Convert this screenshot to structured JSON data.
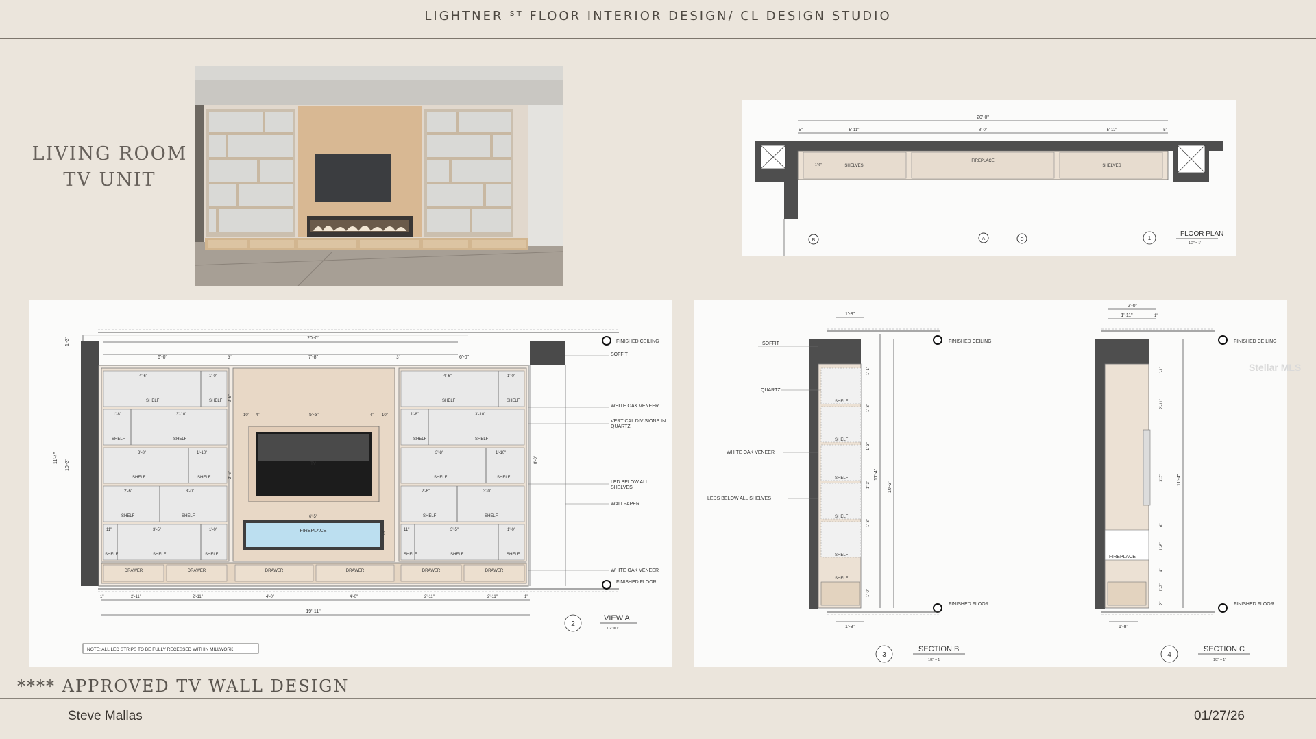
{
  "header": {
    "title": "LIGHTNER ᔆᵀ FLOOR INTERIOR DESIGN/ CL DESIGN STUDIO"
  },
  "side_title": {
    "line1": "LIVING ROOM",
    "line2": "TV UNIT"
  },
  "floor_plan": {
    "overall": "20'-0\"",
    "segments": [
      "5\"",
      "5'-11\"",
      "8'-0\"",
      "5'-11\"",
      "5\""
    ],
    "depth": "1'-6\"",
    "labels": {
      "shelves_left": "SHELVES",
      "fireplace": "FIREPLACE",
      "shelves_right": "SHELVES"
    },
    "markers": [
      "B",
      "A",
      "C"
    ],
    "title_num": "1",
    "title": "FLOOR PLAN",
    "scale": "1/2\" = 1'"
  },
  "view_a": {
    "overall_top": "20'-0\"",
    "top_dims": [
      "6'-0\"",
      "3\"",
      "7'-8\"",
      "3\"",
      "6'-0\""
    ],
    "left_dims": [
      "1'-3\"",
      "11'-4\"",
      "10'-3\""
    ],
    "side_dims": [
      "2'-6\"",
      "1'-3\"",
      "2'-6\"",
      "1'-3\"",
      "8'-0\""
    ],
    "tv_dims": [
      "10\"",
      "4\"",
      "5'-5\"",
      "4\"",
      "10\""
    ],
    "fire_dim": "6'-5\"",
    "fire_h": "1'-3\"",
    "left_col": {
      "row1": [
        "4'-6\"",
        "1'-0\""
      ],
      "row2": [
        "1'-8\"",
        "3'-10\""
      ],
      "row3": [
        "3'-8\"",
        "1'-10\""
      ],
      "row4": [
        "2'-6\"",
        "3'-0\""
      ],
      "row5": [
        "11\"",
        "3'-5\"",
        "1'-0\""
      ]
    },
    "right_col": {
      "row1": [
        "4'-6\"",
        "1'-0\""
      ],
      "row2": [
        "1'-8\"",
        "3'-10\""
      ],
      "row3": [
        "3'-8\"",
        "1'-10\""
      ],
      "row4": [
        "2'-6\"",
        "3'-0\""
      ],
      "row5": [
        "11\"",
        "3'-5\"",
        "1'-0\""
      ]
    },
    "shelf": "SHELF",
    "drawer": "DRAWER",
    "tv": "TV",
    "fireplace": "FIREPLACE",
    "bottom_dims": [
      "1\"",
      "2'-11\"",
      "2'-11\"",
      "4'-0\"",
      "4'-0\"",
      "2'-11\"",
      "2'-11\"",
      "1\""
    ],
    "overall_bottom": "19'-11\"",
    "callouts": [
      "FINISHED CEILING",
      "SOFFIT",
      "WHITE OAK VENEER",
      "VERTICAL DIVISIONS IN",
      "QUARTZ",
      "LED BELOW ALL",
      "SHELVES",
      "WALLPAPER",
      "WHITE OAK VENEER",
      "FINISHED FLOOR"
    ],
    "note": "NOTE: ALL LED STRIPS TO BE FULLY RECESSED WITHIN MILLWORK",
    "title_num": "2",
    "title": "VIEW A",
    "scale": "1/2\" = 1'"
  },
  "section_b": {
    "top_dim": "1'-8\"",
    "bottom_dim": "1'-8\"",
    "callouts": [
      "SOFFIT",
      "QUARTZ",
      "WHITE OAK VENEER",
      "LEDS BELOW ALL SHELVES"
    ],
    "levels": [
      "FINISHED CEILING",
      "FINISHED FLOOR"
    ],
    "shelf": "SHELF",
    "dims": [
      "1'-1\"",
      "1'-3\"",
      "1'-3\"",
      "1'-3\"",
      "1'-3\"",
      "1'-0\""
    ],
    "small": [
      "2\"",
      "2\"",
      "2\"",
      "2\"",
      "2\"",
      "2\""
    ],
    "overall": [
      "11'-4\"",
      "10'-3\""
    ],
    "title_num": "3",
    "title": "SECTION B",
    "scale": "1/2\" = 1'"
  },
  "section_c": {
    "top_dims": [
      "2'-0\"",
      "1'-11\"",
      "1\""
    ],
    "bottom_dim": "1'-8\"",
    "levels": [
      "FINISHED CEILING",
      "FINISHED FLOOR"
    ],
    "fireplace": "FIREPLACE",
    "dims": [
      "1'-1\"",
      "2'-11\"",
      "3'-7\"",
      "6\"",
      "1'-6\"",
      "4\"",
      "1'-2\"",
      "2\""
    ],
    "overall": "11'-4\"",
    "title_num": "4",
    "title": "SECTION C",
    "scale": "1/2\" = 1'"
  },
  "watermark": "Stellar MLS",
  "footer": {
    "approved": "**** APPROVED TV WALL DESIGN",
    "author": "Steve Mallas",
    "date": "01/27/26"
  },
  "colors": {
    "background": "#ebe5dc",
    "panel": "#fbfbfa",
    "wall_dark": "#4e4e4e",
    "oak": "#e8d8c6",
    "fireplace_glass": "#bcdff0"
  }
}
